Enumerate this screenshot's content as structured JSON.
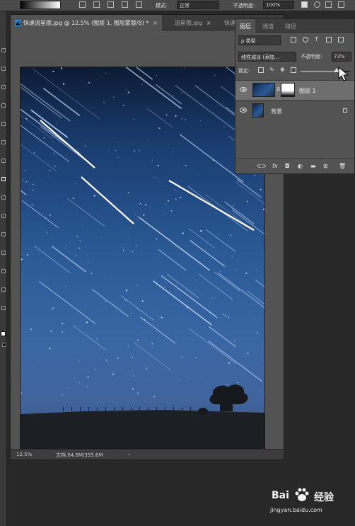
{
  "options_bar": {
    "mode_label": "模式:",
    "mode_value": "正常",
    "opacity_label": "不透明度:",
    "opacity_value": "100%"
  },
  "document": {
    "tabs": [
      {
        "label": "快速流星雨.jpg @ 12.5% (图层 1, 图层蒙版/8) *",
        "active": true
      },
      {
        "label": "流星雨.jpg",
        "active": false
      },
      {
        "label": "快速",
        "active": false
      }
    ],
    "title": "快速流星雨.jpg @ 12.5% (图层 1, 图层蒙版/8) *",
    "status": {
      "zoom": "12.5%",
      "doc_info": "文档:64.8M/355.6M",
      "arrow": "›"
    }
  },
  "layers_panel": {
    "tabs": [
      "图层",
      "通道",
      "路径"
    ],
    "active_tab": "图层",
    "filter_kind": "ρ 类型",
    "blend_mode": "线性减淡 (添加...",
    "opacity_label": "不透明度:",
    "opacity_value": "73%",
    "opacity_level": 0.73,
    "lock_label": "锁定:",
    "layers": [
      {
        "name": "图层 1",
        "selected": true,
        "has_mask": true,
        "locked": false
      },
      {
        "name": "背景",
        "selected": false,
        "has_mask": false,
        "locked": true
      }
    ],
    "footer_icons": [
      "link-icon",
      "fx-icon",
      "mask-icon",
      "adjustment-icon",
      "folder-icon",
      "new-layer-icon",
      "trash-icon"
    ],
    "fx_label": "fx"
  },
  "watermark": {
    "brand": "Bai",
    "brand2": "经验",
    "url": "jingyan.baidu.com"
  },
  "colors": {
    "ui_bg": "#282828",
    "panel_bg": "#535353",
    "accent": "#31a8ff",
    "opacity_value_color": "#ffb8c8"
  }
}
